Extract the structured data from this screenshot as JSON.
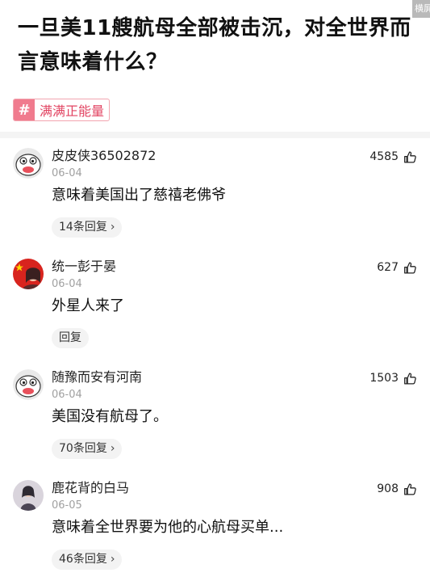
{
  "corner_badge": "横屏",
  "article": {
    "title": "一旦美11艘航母全部被击沉，对全世界而言意味着什么？",
    "tag": {
      "icon": "hash-icon",
      "label": "满满正能量"
    }
  },
  "comments": [
    {
      "username": "皮皮侠36502872",
      "date": "06-04",
      "text": "意味着美国出了慈禧老佛爷",
      "replies": "14条回复",
      "likes": "4585",
      "avatar": "cartoon-face-avatar"
    },
    {
      "username": "统一彭于晏",
      "date": "06-04",
      "text": "外星人来了",
      "replies": "回复",
      "likes": "627",
      "avatar": "flag-portrait-avatar"
    },
    {
      "username": "随豫而安有河南",
      "date": "06-04",
      "text": "美国没有航母了。",
      "replies": "70条回复",
      "likes": "1503",
      "avatar": "cartoon-face-avatar"
    },
    {
      "username": "鹿花背的白马",
      "date": "06-05",
      "text": "意味着全世界要为他的心航母买单...",
      "replies": "46条回复",
      "likes": "908",
      "avatar": "photo-portrait-avatar"
    }
  ]
}
